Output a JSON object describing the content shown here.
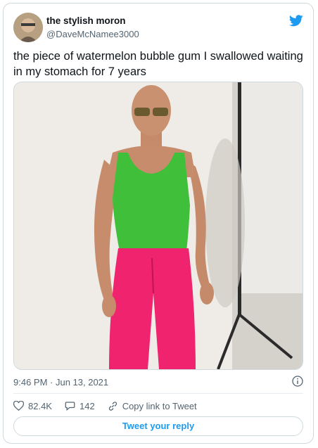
{
  "author": {
    "display_name": "the stylish moron",
    "handle": "@DaveMcNamee3000",
    "avatar_icon": "profile-photo"
  },
  "brand": {
    "icon": "twitter-bird-icon",
    "color": "#1d9bf0"
  },
  "tweet": {
    "text": "the piece of watermelon bubble gum I swallowed waiting in my stomach for 7 years",
    "timestamp": "9:46 PM · Jun 13, 2021"
  },
  "media": {
    "description_icon": "photo",
    "colors": {
      "tank_top": "#3fbf3a",
      "pants": "#f0246e",
      "backdrop": "#eeebe6"
    }
  },
  "actions": {
    "likes": "82.4K",
    "replies": "142",
    "copy_link": "Copy link to Tweet"
  },
  "reply_button": {
    "label": "Tweet your reply"
  }
}
